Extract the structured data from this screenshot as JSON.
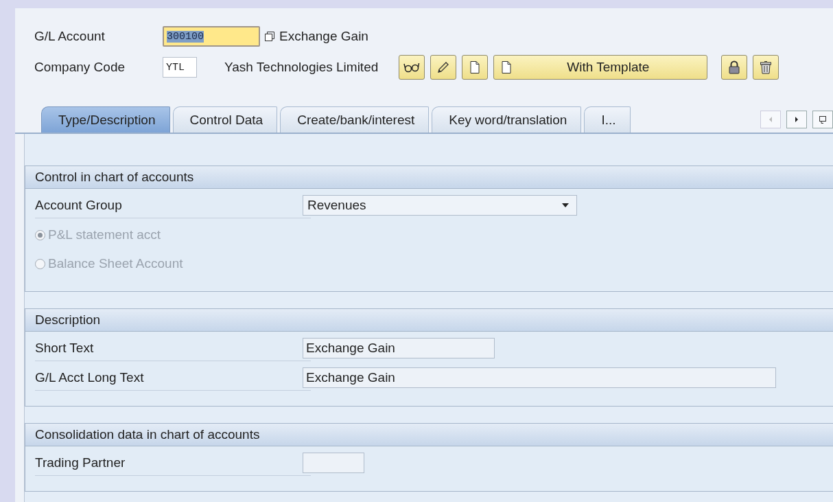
{
  "header": {
    "fields": [
      {
        "label": "G/L Account",
        "value": "300100",
        "focused": true,
        "description": "Exchange Gain"
      },
      {
        "label": "Company Code",
        "value": "YTL",
        "focused": false,
        "description": "Yash Technologies Limited"
      }
    ],
    "toolbar": [
      {
        "kind": "display"
      },
      {
        "kind": "change"
      },
      {
        "kind": "create"
      },
      {
        "kind": "template",
        "label": "With Template"
      },
      {
        "kind": "lock"
      },
      {
        "kind": "delete"
      }
    ]
  },
  "tabs": [
    {
      "label": "Type/Description",
      "selected": true
    },
    {
      "label": "Control Data",
      "selected": false
    },
    {
      "label": "Create/bank/interest",
      "selected": false
    },
    {
      "label": "Key word/translation",
      "selected": false
    },
    {
      "label": "I...",
      "selected": false
    }
  ],
  "groups": [
    {
      "title": "Control in chart of accounts",
      "rows": [
        {
          "kind": "dropdown",
          "label": "Account Group",
          "value": "Revenues"
        },
        {
          "kind": "radio",
          "label": "P&L statement acct",
          "selected": true,
          "disabled": true
        },
        {
          "kind": "radio",
          "label": "Balance Sheet Account",
          "selected": false,
          "disabled": true
        }
      ]
    },
    {
      "title": "Description",
      "rows": [
        {
          "kind": "text",
          "label": "Short Text",
          "value": "Exchange Gain"
        },
        {
          "kind": "text",
          "label": "G/L Acct Long Text",
          "value": "Exchange Gain"
        }
      ]
    },
    {
      "title": "Consolidation data in chart of accounts",
      "rows": [
        {
          "kind": "text",
          "label": "Trading Partner"
        }
      ]
    }
  ]
}
